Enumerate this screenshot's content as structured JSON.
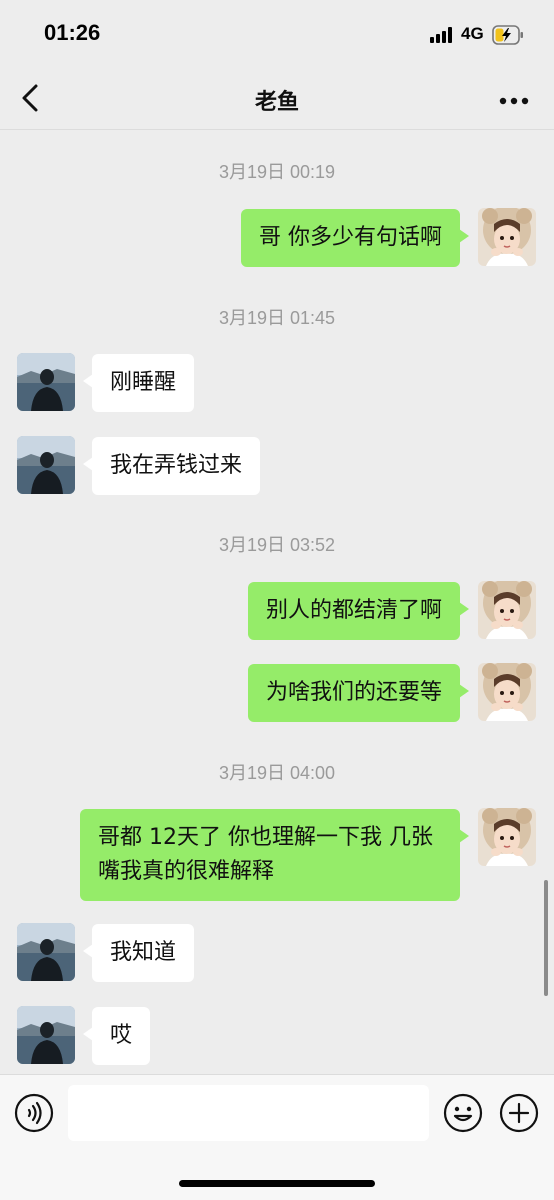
{
  "status_bar": {
    "time": "01:26",
    "network": "4G",
    "icons": [
      "signal-icon",
      "battery-charging-icon"
    ]
  },
  "nav": {
    "title": "老鱼",
    "back_icon": "chevron-left-icon",
    "more_icon": "more-icon"
  },
  "chat": {
    "timestamps": [
      "3月19日 00:19",
      "3月19日 01:45",
      "3月19日 03:52",
      "3月19日 04:00"
    ],
    "messages": [
      {
        "sender": "me",
        "text": "哥 你多少有句话啊"
      },
      {
        "sender": "contact",
        "text": "刚睡醒"
      },
      {
        "sender": "contact",
        "text": "我在弄钱过来"
      },
      {
        "sender": "me",
        "text": "别人的都结清了啊"
      },
      {
        "sender": "me",
        "text": "为啥我们的还要等"
      },
      {
        "sender": "me",
        "text": "哥都 12天了  你也理解一下我 几张嘴我真的很难解释"
      },
      {
        "sender": "contact",
        "text": "我知道"
      },
      {
        "sender": "contact",
        "text": "哎"
      }
    ]
  },
  "input_bar": {
    "value": "",
    "icons": [
      "voice-icon",
      "emoji-icon",
      "plus-icon"
    ]
  },
  "colors": {
    "background": "#ededed",
    "outgoing_bubble": "#95ec69",
    "incoming_bubble": "#ffffff",
    "timestamp": "#9a9a9a"
  }
}
